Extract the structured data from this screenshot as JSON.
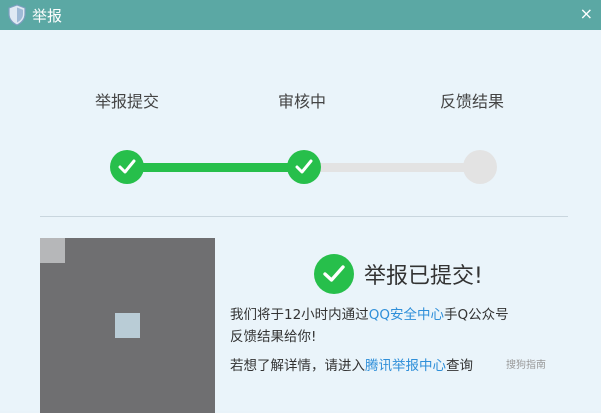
{
  "window": {
    "title": "举报",
    "close_glyph": "×",
    "accent_color": "#5ba8a4"
  },
  "steps": [
    {
      "label": "举报提交",
      "status": "done"
    },
    {
      "label": "审核中",
      "status": "done"
    },
    {
      "label": "反馈结果",
      "status": "pending"
    }
  ],
  "progress": {
    "completed_steps": 2,
    "total_steps": 3
  },
  "colors": {
    "success": "#27bf4b",
    "link": "#2f8fd9"
  },
  "result": {
    "title": "举报已提交!",
    "line1_prefix": "我们将于12小时内通过",
    "line1_link": "QQ安全中心",
    "line1_suffix": "手Q公众号",
    "line2": "反馈结果给你!",
    "line3_prefix": "若想了解详情，请进入",
    "line3_link": "腾讯举报中心",
    "line3_suffix": "查询"
  },
  "watermark": "搜狗指南"
}
